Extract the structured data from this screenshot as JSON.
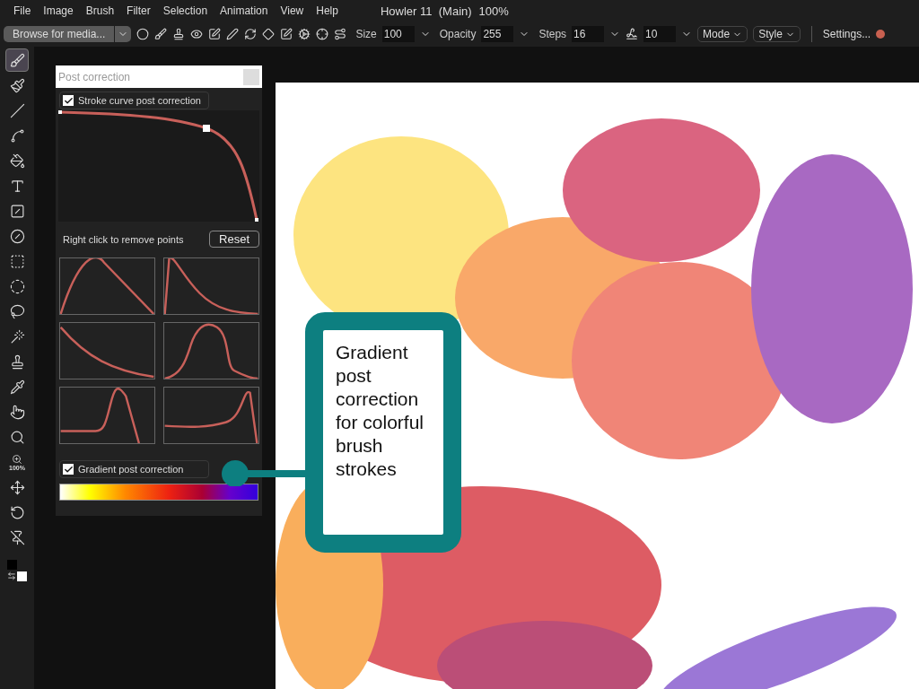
{
  "menu": {
    "items": [
      "File",
      "Image",
      "Brush",
      "Filter",
      "Selection",
      "Animation",
      "View",
      "Help"
    ],
    "title": "Howler 11  (Main)",
    "zoom": "100%"
  },
  "toolbar": {
    "media_button": "Browse for media...",
    "fields": [
      {
        "label": "Size",
        "value": "100"
      },
      {
        "label": "Opacity",
        "value": "255"
      },
      {
        "label": "Steps",
        "value": "16"
      },
      {
        "value": "10"
      }
    ],
    "dropdowns": [
      "Mode",
      "Style"
    ],
    "settings": "Settings..."
  },
  "tools": [
    {
      "selected": true
    },
    {
      "selected": false
    },
    {
      "selected": false
    },
    {
      "selected": false
    },
    {
      "selected": false
    },
    {
      "selected": false
    },
    {
      "selected": false
    },
    {
      "selected": false
    },
    {
      "selected": false
    },
    {
      "selected": false
    },
    {
      "selected": false
    },
    {
      "selected": false
    },
    {
      "selected": false
    },
    {
      "selected": false
    },
    {
      "selected": false
    },
    {
      "selected": false
    },
    {
      "selected": false,
      "label": "100%"
    },
    {
      "selected": false
    },
    {
      "selected": false
    },
    {
      "selected": false
    }
  ],
  "panel": {
    "title": "Post correction",
    "stroke_curve": {
      "label": "Stroke curve post correction",
      "checked": true
    },
    "hint": "Right click to remove points",
    "reset": "Reset",
    "gradient": {
      "label": "Gradient post correction",
      "checked": true
    }
  },
  "callout": {
    "text": "Gradient post correction for colorful brush strokes"
  }
}
